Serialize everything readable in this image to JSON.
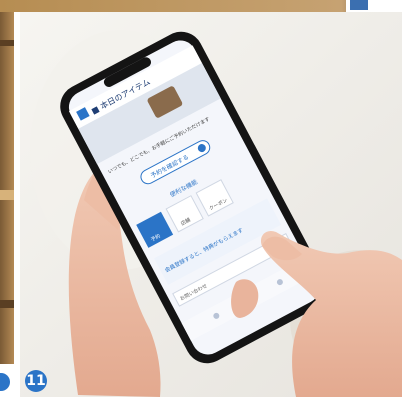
{
  "photo": {
    "badge_number": "11",
    "description_icon": "smartphone-photo"
  },
  "phone_screen": {
    "header_title": "■ 本日のアイテム",
    "intro_text": "いつでも、どこでも、お手軽にご予約いただけます",
    "primary_button_label": "予約を確認する",
    "section_title": "便利な機能",
    "feature_labels": [
      "予約",
      "店舗",
      "クーポン"
    ],
    "highlight_text": "会員登録すると、特典がもらえます",
    "footer_text": "お問い合わせ"
  },
  "colors": {
    "accent_blue": "#2b74c7",
    "phone_black": "#141414",
    "screen_bg": "#f4f6fb"
  }
}
